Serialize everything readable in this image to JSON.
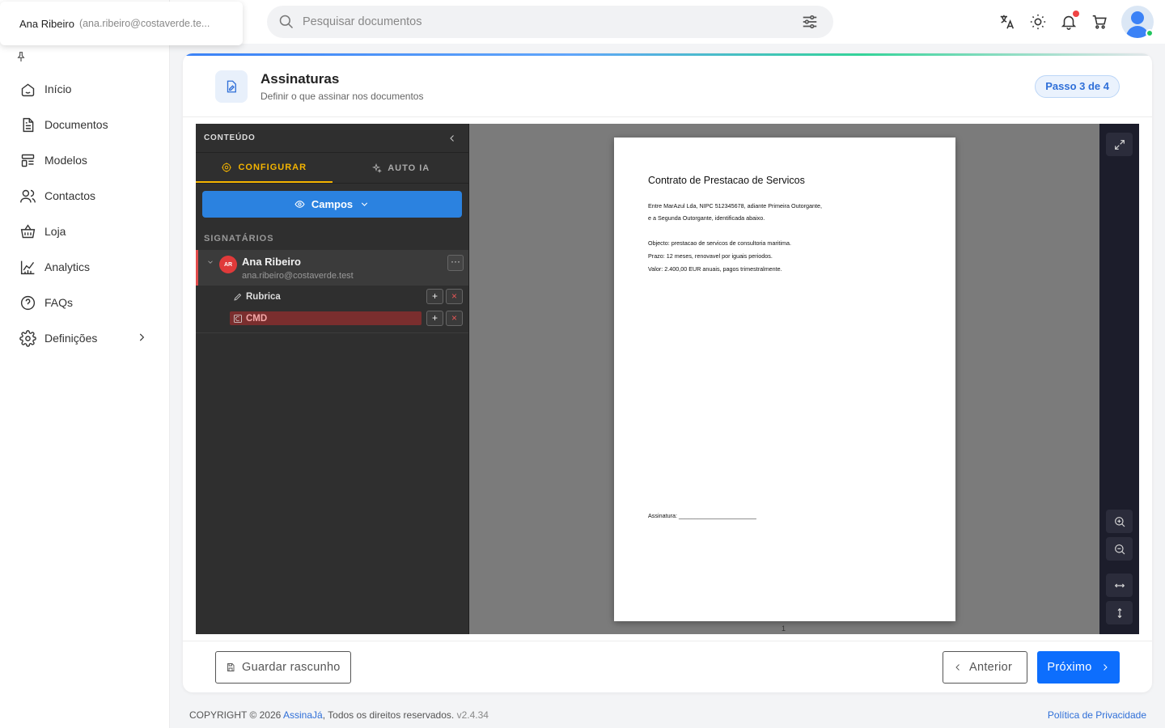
{
  "user": {
    "name": "Ana Ribeiro",
    "email": "(ana.ribeiro@costaverde.te..."
  },
  "sidebar": {
    "items": [
      {
        "label": "Início",
        "icon": "home-icon"
      },
      {
        "label": "Documentos",
        "icon": "document-icon"
      },
      {
        "label": "Modelos",
        "icon": "template-icon"
      },
      {
        "label": "Contactos",
        "icon": "contacts-icon"
      },
      {
        "label": "Loja",
        "icon": "basket-icon"
      },
      {
        "label": "Analytics",
        "icon": "chart-icon"
      },
      {
        "label": "FAQs",
        "icon": "help-icon"
      },
      {
        "label": "Definições",
        "icon": "gear-icon"
      }
    ]
  },
  "search": {
    "placeholder": "Pesquisar documentos"
  },
  "header": {
    "title": "Assinaturas",
    "subtitle": "Definir o que assinar nos documentos",
    "step": "Passo 3 de 4"
  },
  "left_panel": {
    "title": "CONTEÚDO",
    "tabs": [
      {
        "label": "CONFIGURAR",
        "active": true
      },
      {
        "label": "AUTO IA",
        "active": false
      }
    ],
    "campos_label": "Campos",
    "section_label": "SIGNATÁRIOS",
    "signer": {
      "initials": "AR",
      "name": "Ana Ribeiro",
      "email": "ana.ribeiro@costaverde.test",
      "more": "···",
      "fields": [
        {
          "label": "Rubrica",
          "error": false
        },
        {
          "label": "CMD",
          "error": true
        }
      ],
      "add_label": "+",
      "remove_label": "×"
    }
  },
  "document": {
    "title": "Contrato de Prestacao de Servicos",
    "lines": [
      "Entre MarAzul Lda, NIPC 512345678, adiante Primeira Outorgante,",
      "e a Segunda Outorgante, identificada abaixo.",
      "Objecto: prestacao de servicos de consultoria maritima.",
      "Prazo: 12 meses, renovavel por iguais periodos.",
      "Valor: 2.400,00 EUR anuais, pagos trimestralmente."
    ],
    "signature_line": "Assinatura: ________________________",
    "page_number": "1"
  },
  "footer_buttons": {
    "draft": "Guardar rascunho",
    "previous": "Anterior",
    "next": "Próximo"
  },
  "page_footer": {
    "copyright": "COPYRIGHT © 2026 ",
    "brand": "AssinaJá",
    "rights": ", Todos os direitos reservados.",
    "version": "v2.4.34",
    "privacy": "Política de Privacidade"
  },
  "colors": {
    "primary": "#0d6efd",
    "accent_tab": "#f4b400",
    "error": "#e14b4b",
    "panel_bg": "#2f2f2f"
  }
}
